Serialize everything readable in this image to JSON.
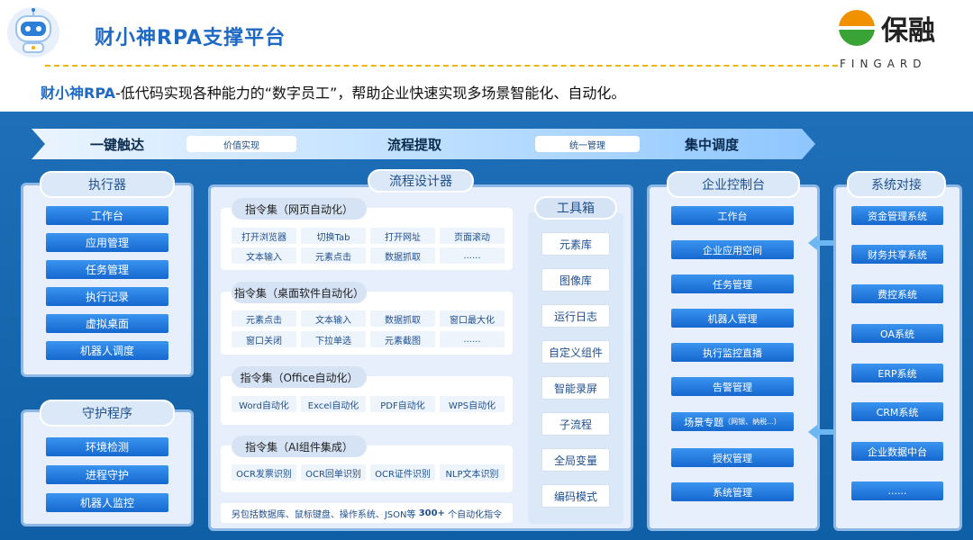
{
  "header": {
    "title": "财小神RPA支撑平台",
    "brand_cn": "保融",
    "brand_en": "FINGARD",
    "subtitle_bold": "财小神RPA",
    "subtitle_rest": "-低代码实现各种能力的“数字员工”，帮助企业快速实现多场景智能化、自动化。"
  },
  "flow": {
    "stages": [
      "一键触达",
      "流程提取",
      "集中调度"
    ],
    "connectors": [
      "价值实现",
      "统一管理"
    ]
  },
  "executor": {
    "title": "执行器",
    "items": [
      "工作台",
      "应用管理",
      "任务管理",
      "执行记录",
      "虚拟桌面",
      "机器人调度"
    ]
  },
  "guardian": {
    "title": "守护程序",
    "items": [
      "环境检测",
      "进程守护",
      "机器人监控"
    ]
  },
  "designer": {
    "title": "流程设计器",
    "groups": [
      {
        "prefix": "指令集",
        "title": "网页自动化",
        "rows": [
          [
            "打开浏览器",
            "切换Tab",
            "打开网址",
            "页面滚动"
          ],
          [
            "文本输入",
            "元素点击",
            "数据抓取",
            "......"
          ]
        ]
      },
      {
        "prefix": "指令集",
        "title": "桌面软件自动化",
        "rows": [
          [
            "元素点击",
            "文本输入",
            "数据抓取",
            "窗口最大化"
          ],
          [
            "窗口关闭",
            "下拉单选",
            "元素截图",
            "......"
          ]
        ]
      },
      {
        "prefix": "指令集",
        "title": "Office自动化",
        "rows": [
          [
            "Word自动化",
            "Excel自动化",
            "PDF自动化",
            "WPS自动化"
          ]
        ]
      },
      {
        "prefix": "指令集",
        "title": "AI组件集成",
        "rows": [
          [
            "OCR发票识别",
            "OCR回单识别",
            "OCR证件识别",
            "NLP文本识别"
          ]
        ]
      }
    ],
    "footer_a": "另包括数据库、鼠标键盘、操作系统、JSON等",
    "footer_b": "300+",
    "footer_c": "个自动化指令"
  },
  "toolbox": {
    "title": "工具箱",
    "items": [
      "元素库",
      "图像库",
      "运行日志",
      "自定义组件",
      "智能录屏",
      "子流程",
      "全局变量",
      "编码模式"
    ]
  },
  "console": {
    "title": "企业控制台",
    "items": [
      "工作台",
      "企业应用空间",
      "任务管理",
      "机器人管理",
      "执行监控直播",
      "告警管理",
      "场景专题",
      "授权管理",
      "系统管理"
    ],
    "scene_note": "（网银、纳税...）"
  },
  "systems": {
    "title": "系统对接",
    "items": [
      "资金管理系统",
      "财务共享系统",
      "费控系统",
      "OA系统",
      "ERP系统",
      "CRM系统",
      "企业数据中台",
      "......"
    ]
  },
  "colors": {
    "brand_blue": "#1d69c4",
    "board_blue": "#1565ad",
    "accent_yellow": "#f0b400",
    "logo_green": "#3aa335",
    "logo_orange": "#f29100"
  },
  "icons": [
    "robot-icon",
    "fingard-logo-icon",
    "double-arrow-icon"
  ]
}
